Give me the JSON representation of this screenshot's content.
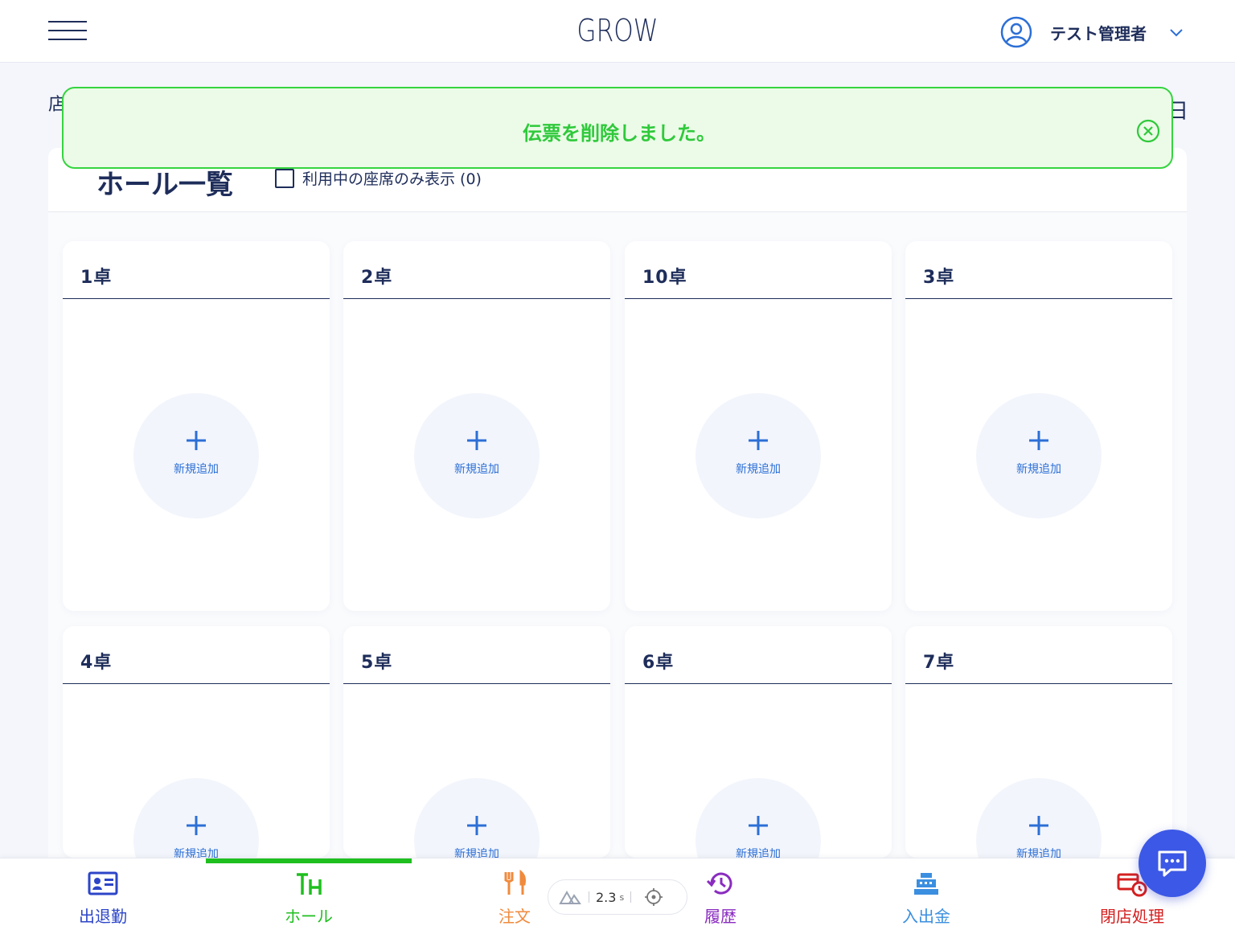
{
  "header": {
    "logo": "GROW",
    "user_name": "テスト管理者"
  },
  "under_toast": {
    "store_partial": "店",
    "date_partial": "日"
  },
  "toast": {
    "message": "伝票を削除しました。",
    "color": "#2fc93b"
  },
  "hall": {
    "title": "ホール一覧",
    "filter_label": "利用中の座席のみ表示 (0)",
    "add_label": "新規追加",
    "tables": [
      {
        "name": "1卓"
      },
      {
        "name": "2卓"
      },
      {
        "name": "10卓"
      },
      {
        "name": "3卓"
      },
      {
        "name": "4卓"
      },
      {
        "name": "5卓"
      },
      {
        "name": "6卓"
      },
      {
        "name": "7卓"
      }
    ]
  },
  "bottom_nav": {
    "items": [
      {
        "label": "出退勤",
        "icon": "id-card-icon",
        "color": "#2c45c8"
      },
      {
        "label": "ホール",
        "icon": "hall-icon",
        "color": "#1fbf1f"
      },
      {
        "label": "注文",
        "icon": "fork-knife-icon",
        "color": "#f08a3c"
      },
      {
        "label": "履歴",
        "icon": "history-icon",
        "color": "#8a2cc0"
      },
      {
        "label": "入出金",
        "icon": "cash-register-icon",
        "color": "#3b8fe0"
      },
      {
        "label": "閉店処理",
        "icon": "close-store-icon",
        "color": "#d42020"
      }
    ],
    "active_index": 1
  },
  "perf_badge": {
    "value": "2.3",
    "unit": "s"
  }
}
